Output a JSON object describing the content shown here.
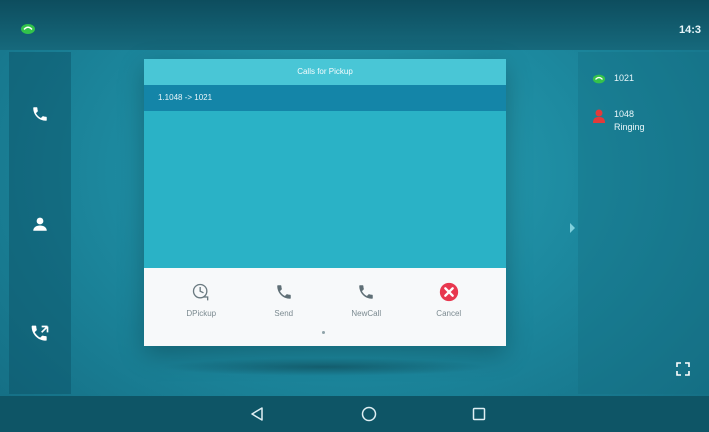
{
  "status_bar": {
    "status_icon": "account-registered-icon",
    "clock": "14:3"
  },
  "left_sidebar": {
    "items": [
      {
        "icon": "phone-icon"
      },
      {
        "icon": "contacts-icon"
      },
      {
        "icon": "call-history-icon"
      }
    ]
  },
  "dialog": {
    "title": "Calls for Pickup",
    "calls": [
      {
        "label": "1.1048 -> 1021"
      }
    ],
    "softkeys": [
      {
        "label": "DPickup",
        "icon": "dpickup-icon"
      },
      {
        "label": "Send",
        "icon": "phone-icon"
      },
      {
        "label": "NewCall",
        "icon": "phone-icon"
      },
      {
        "label": "Cancel",
        "icon": "cancel-icon"
      }
    ]
  },
  "right_panel": {
    "lines": [
      {
        "label": "1021",
        "status": "",
        "icon": "registered-line-icon",
        "color": "#35c24a"
      },
      {
        "label": "1048",
        "status": "Ringing",
        "icon": "blf-ringing-icon",
        "color": "#e23a3a"
      }
    ]
  },
  "nav_bar": {
    "buttons": [
      "back-icon",
      "home-icon",
      "recents-icon"
    ]
  },
  "colors": {
    "background": "#1d8aa0",
    "dialog": "#2ab2c6",
    "dialog_title": "#49c6d6",
    "selected_row": "#1485a8",
    "softkey_bar": "#f7f9fa",
    "cancel": "#e8384f"
  }
}
